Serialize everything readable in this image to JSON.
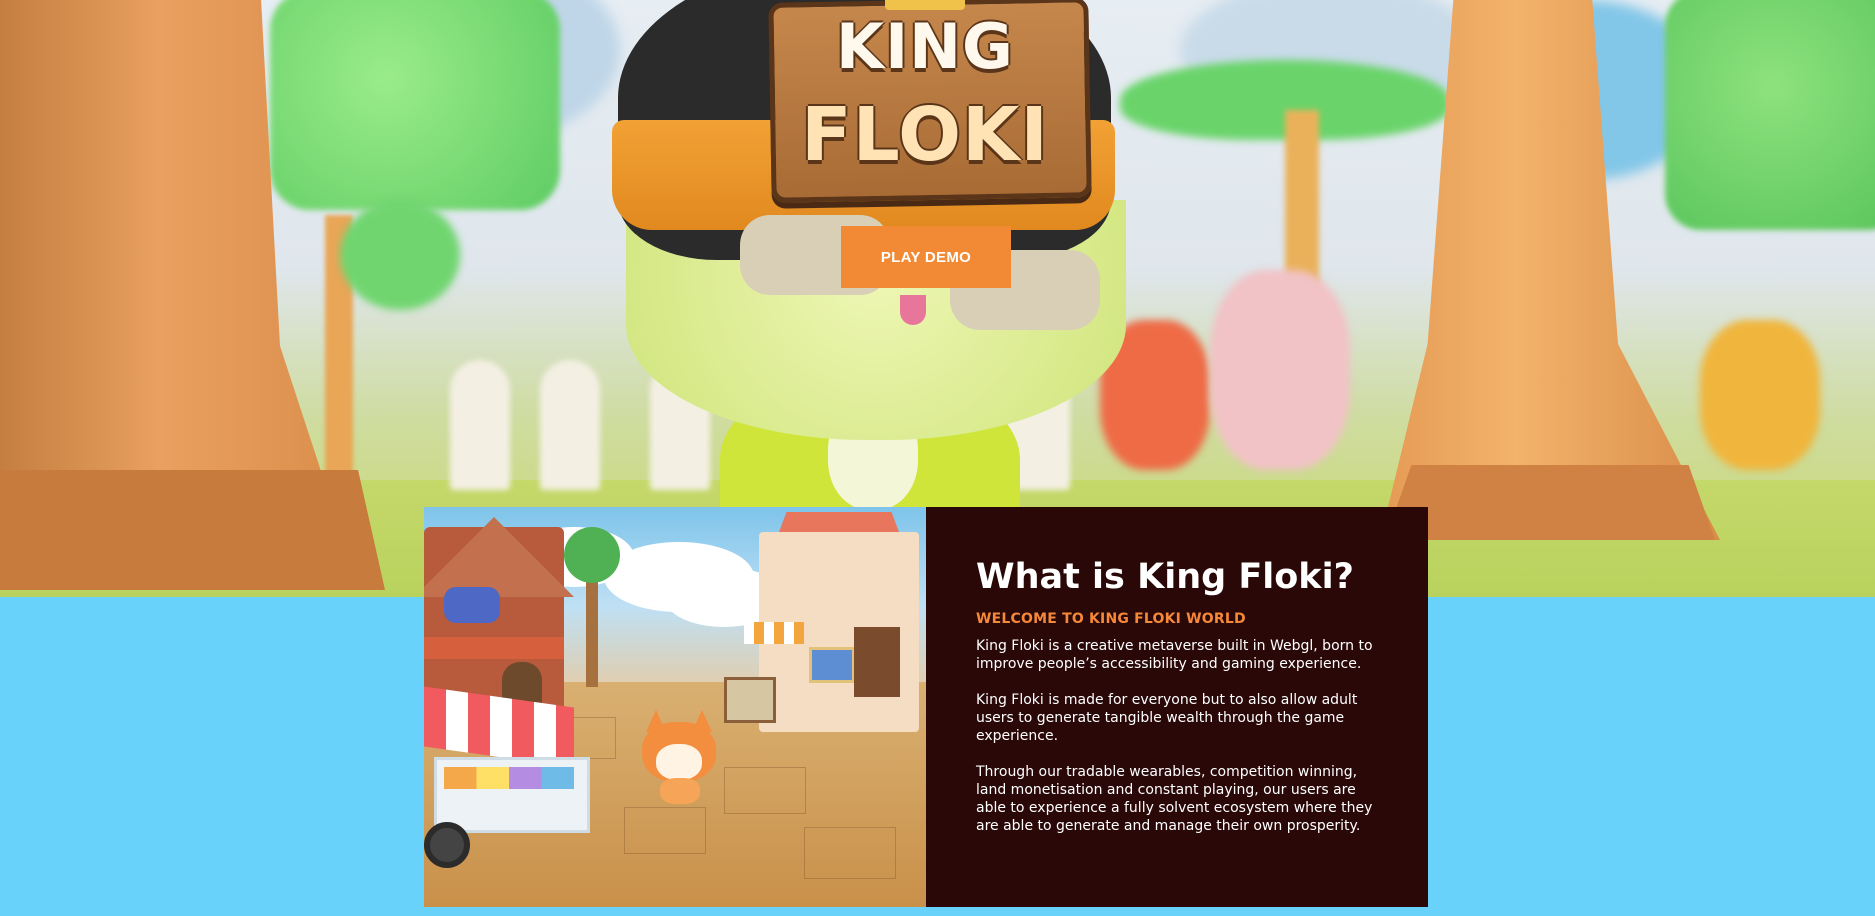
{
  "hero": {
    "logo": {
      "line1": "KING",
      "line2": "FLOKI"
    },
    "play_demo_label": "PLAY DEMO"
  },
  "about": {
    "title": "What is King Floki?",
    "subtitle": "WELCOME TO KING FLOKI WORLD",
    "paragraphs": [
      "King Floki is a creative metaverse built in Webgl, born to improve people’s accessibility and gaming experience.",
      "King Floki is made for everyone but to also allow adult users to generate tangible wealth through the game experience.",
      "Through our tradable wearables, competition winning, land monetisation and constant playing, our users are able to experience a fully solvent ecosystem where they are able to generate and manage their own prosperity."
    ]
  },
  "colors": {
    "accent": "#f28a35",
    "page_background": "#68d2fb",
    "panel_background": "#2a0808",
    "subtitle": "#f6883a"
  }
}
